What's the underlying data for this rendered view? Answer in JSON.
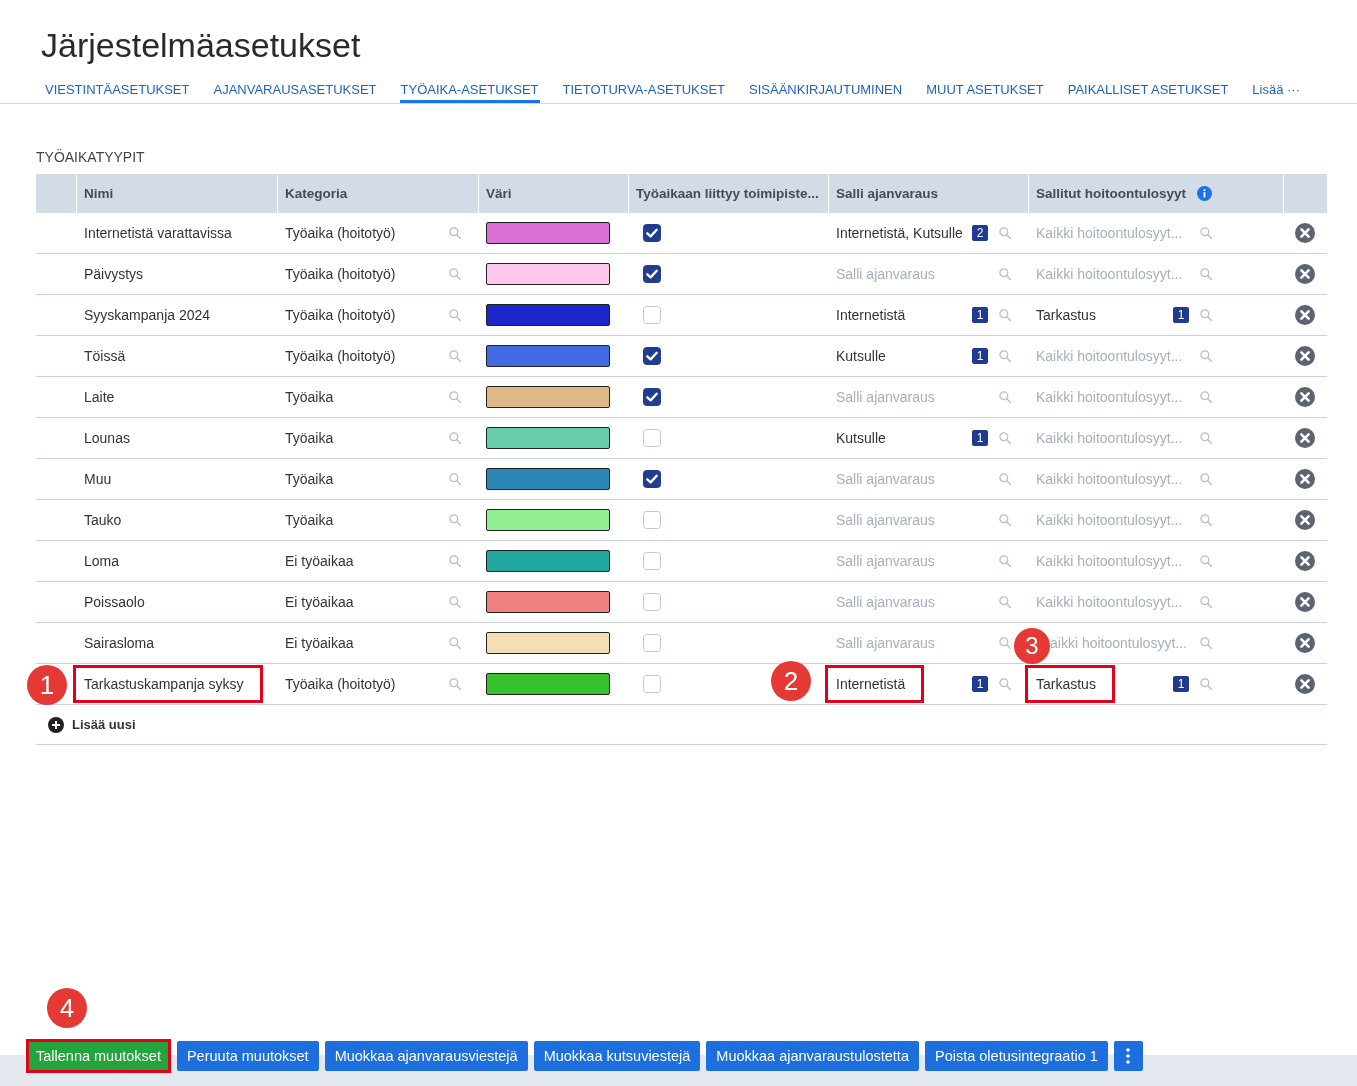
{
  "page": {
    "title": "Järjestelmäasetukset"
  },
  "tabs": [
    {
      "label": "VIESTINTÄASETUKSET",
      "selected": false
    },
    {
      "label": "AJANVARAUSASETUKSET",
      "selected": false
    },
    {
      "label": "TYÖAIKA-ASETUKSET",
      "selected": true
    },
    {
      "label": "TIETOTURVA-ASETUKSET",
      "selected": false
    },
    {
      "label": "SISÄÄNKIRJAUTUMINEN",
      "selected": false
    },
    {
      "label": "MUUT ASETUKSET",
      "selected": false
    },
    {
      "label": "PAIKALLISET ASETUKSET",
      "selected": false
    },
    {
      "label": "Lisää ···",
      "selected": false
    }
  ],
  "section": {
    "title": "TYÖAIKATYYPIT",
    "columns": [
      {
        "label": "Nimi",
        "info": false
      },
      {
        "label": "Kategoria",
        "info": false
      },
      {
        "label": "Väri",
        "info": false
      },
      {
        "label": "Työaikaan liittyy toimipiste...",
        "info": false
      },
      {
        "label": "Salli ajanvaraus",
        "info": false
      },
      {
        "label": "Sallitut hoitoontulosyyt",
        "info": true
      }
    ],
    "rows": [
      {
        "name": {
          "text": "Internetistä varattavissa",
          "marked": false
        },
        "category": "Työaika (hoitotyö)",
        "color": "#da70d6",
        "checked": true,
        "booking": {
          "value": "Internetistä, Kutsulle",
          "count": "2",
          "marked": false
        },
        "reasons": {
          "placeholder": "Kaikki hoitoontulosyyt...",
          "marked": false
        }
      },
      {
        "name": {
          "text": "Päivystys",
          "marked": false
        },
        "category": "Työaika (hoitotyö)",
        "color": "#ffc6ee",
        "checked": true,
        "booking": {
          "placeholder": "Salli ajanvaraus",
          "marked": false
        },
        "reasons": {
          "placeholder": "Kaikki hoitoontulosyyt...",
          "marked": false
        }
      },
      {
        "name": {
          "text": "Syyskampanja 2024",
          "marked": false
        },
        "category": "Työaika (hoitotyö)",
        "color": "#1b27c8",
        "checked": false,
        "booking": {
          "value": "Internetistä",
          "count": "1",
          "marked": false
        },
        "reasons": {
          "value": "Tarkastus",
          "count": "1",
          "marked": false
        }
      },
      {
        "name": {
          "text": "Töissä",
          "marked": false
        },
        "category": "Työaika (hoitotyö)",
        "color": "#4169e1",
        "checked": true,
        "booking": {
          "value": "Kutsulle",
          "count": "1",
          "marked": false
        },
        "reasons": {
          "placeholder": "Kaikki hoitoontulosyyt...",
          "marked": false
        }
      },
      {
        "name": {
          "text": "Laite",
          "marked": false
        },
        "category": "Työaika",
        "color": "#deb887",
        "checked": true,
        "booking": {
          "placeholder": "Salli ajanvaraus",
          "marked": false
        },
        "reasons": {
          "placeholder": "Kaikki hoitoontulosyyt...",
          "marked": false
        }
      },
      {
        "name": {
          "text": "Lounas",
          "marked": false
        },
        "category": "Työaika",
        "color": "#66cdaa",
        "checked": false,
        "booking": {
          "value": "Kutsulle",
          "count": "1",
          "marked": false
        },
        "reasons": {
          "placeholder": "Kaikki hoitoontulosyyt...",
          "marked": false
        }
      },
      {
        "name": {
          "text": "Muu",
          "marked": false
        },
        "category": "Työaika",
        "color": "#2a88b6",
        "checked": true,
        "booking": {
          "placeholder": "Salli ajanvaraus",
          "marked": false
        },
        "reasons": {
          "placeholder": "Kaikki hoitoontulosyyt...",
          "marked": false
        }
      },
      {
        "name": {
          "text": "Tauko",
          "marked": false
        },
        "category": "Työaika",
        "color": "#90ee90",
        "checked": false,
        "booking": {
          "placeholder": "Salli ajanvaraus",
          "marked": false
        },
        "reasons": {
          "placeholder": "Kaikki hoitoontulosyyt...",
          "marked": false
        }
      },
      {
        "name": {
          "text": "Loma",
          "marked": false
        },
        "category": "Ei työaikaa",
        "color": "#20a89e",
        "checked": false,
        "booking": {
          "placeholder": "Salli ajanvaraus",
          "marked": false
        },
        "reasons": {
          "placeholder": "Kaikki hoitoontulosyyt...",
          "marked": false
        }
      },
      {
        "name": {
          "text": "Poissaolo",
          "marked": false
        },
        "category": "Ei työaikaa",
        "color": "#f08080",
        "checked": false,
        "booking": {
          "placeholder": "Salli ajanvaraus",
          "marked": false
        },
        "reasons": {
          "placeholder": "Kaikki hoitoontulosyyt...",
          "marked": false
        }
      },
      {
        "name": {
          "text": "Sairasloma",
          "marked": false
        },
        "category": "Ei työaikaa",
        "color": "#f5deb3",
        "checked": false,
        "booking": {
          "placeholder": "Salli ajanvaraus",
          "marked": false
        },
        "reasons": {
          "placeholder": "aikki hoitoontulosyyt...",
          "marked": false
        }
      },
      {
        "name": {
          "text": "Tarkastuskampanja syksy",
          "marked": true,
          "callout": "1"
        },
        "category": "Työaika (hoitotyö)",
        "color": "#36c22a",
        "checked": false,
        "booking": {
          "value": "Internetistä",
          "count": "1",
          "marked": true,
          "callout": "2"
        },
        "reasons": {
          "value": "Tarkastus",
          "count": "1",
          "marked": true,
          "callout": "3"
        }
      }
    ],
    "add_label": "Lisää uusi"
  },
  "footer": {
    "buttons": [
      {
        "label": "Tallenna muutokset",
        "kind": "primary",
        "marked": true,
        "callout": "4"
      },
      {
        "label": "Peruuta muutokset",
        "kind": "default",
        "marked": false
      },
      {
        "label": "Muokkaa ajanvarausviestejä",
        "kind": "default",
        "marked": false
      },
      {
        "label": "Muokkaa kutsuviestejä",
        "kind": "default",
        "marked": false
      },
      {
        "label": "Muokkaa ajanvaraustulostetta",
        "kind": "default",
        "marked": false
      },
      {
        "label": "Poista oletusintegraatio 1",
        "kind": "default",
        "marked": false
      },
      {
        "kind": "menu",
        "marked": false
      }
    ]
  }
}
